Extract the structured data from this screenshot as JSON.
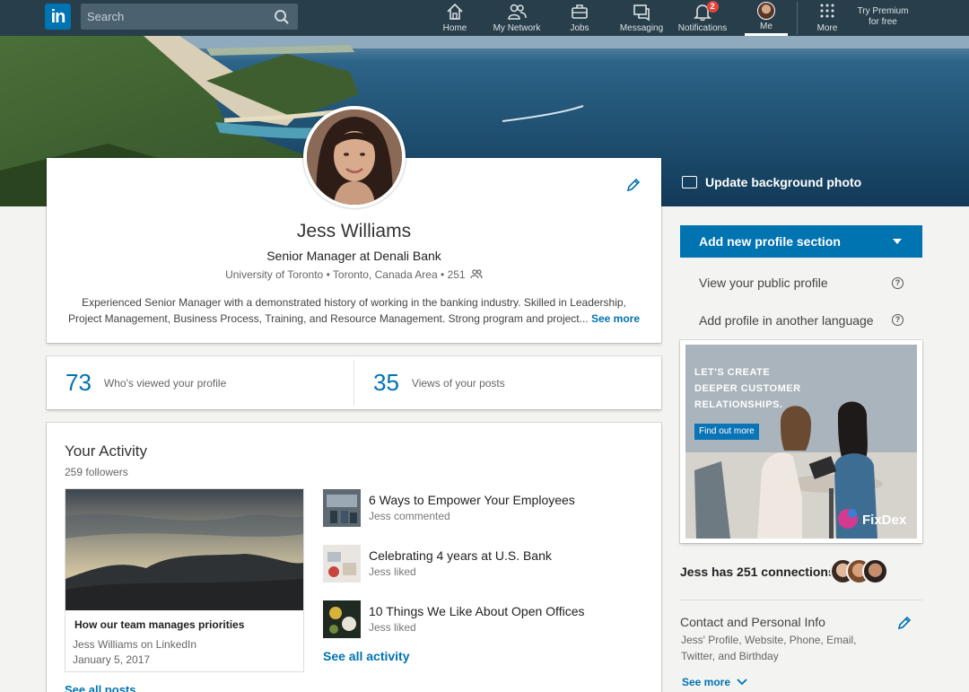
{
  "nav": {
    "logo": "in",
    "search_placeholder": "Search",
    "items": [
      {
        "label": "Home",
        "icon": "home-icon"
      },
      {
        "label": "My Network",
        "icon": "network-icon"
      },
      {
        "label": "Jobs",
        "icon": "briefcase-icon"
      },
      {
        "label": "Messaging",
        "icon": "messaging-icon"
      },
      {
        "label": "Notifications",
        "icon": "bell-icon",
        "badge": "2"
      },
      {
        "label": "Me",
        "icon": "me-avatar"
      },
      {
        "label": "More",
        "icon": "grid-icon"
      }
    ],
    "premium_line1": "Try Premium",
    "premium_line2": "for free"
  },
  "banner": {
    "update_bg_label": "Update background photo"
  },
  "profile": {
    "name": "Jess Williams",
    "headline": "Senior Manager at Denali Bank",
    "school": "University of Toronto",
    "location": "Toronto, Canada Area",
    "connections_count": "251",
    "summary": "Experienced Senior Manager with a demonstrated history of working in the banking industry. Skilled in Leadership, Project Management, Business Process, Training, and Resource Management. Strong program and project...",
    "see_more": "See more"
  },
  "stats": {
    "profile_views": "73",
    "profile_views_label": "Who's viewed your profile",
    "post_views": "35",
    "post_views_label": "Views of your posts"
  },
  "activity": {
    "title": "Your Activity",
    "followers": "259 followers",
    "post": {
      "title": "How our team manages priorities",
      "author": "Jess Williams on LinkedIn",
      "date": "January 5, 2017"
    },
    "items": [
      {
        "title": "6 Ways to Empower Your Employees",
        "sub": "Jess commented"
      },
      {
        "title": "Celebrating 4 years at U.S. Bank",
        "sub": "Jess liked"
      },
      {
        "title": "10 Things We Like About Open Offices",
        "sub": "Jess liked"
      }
    ],
    "see_all_activity": "See all activity",
    "see_all_posts": "See all posts"
  },
  "rail": {
    "add_section": "Add new profile section",
    "public_profile": "View your public profile",
    "another_language": "Add profile in another language",
    "ad": {
      "line1": "LET'S CREATE",
      "line2": "DEEPER CUSTOMER",
      "line3": "RELATIONSHIPS.",
      "cta": "Find out more",
      "brand": "FixDex"
    },
    "connections_text": "Jess has 251 connections",
    "contact_title": "Contact and Personal Info",
    "contact_sub": "Jess' Profile, Website, Phone, Email, Twitter, and Birthday",
    "see_more": "See more"
  },
  "colors": {
    "nav_bg": "#283e4a",
    "accent": "#0073b1",
    "badge": "#e0463c",
    "page_bg": "#f3f3f2"
  }
}
